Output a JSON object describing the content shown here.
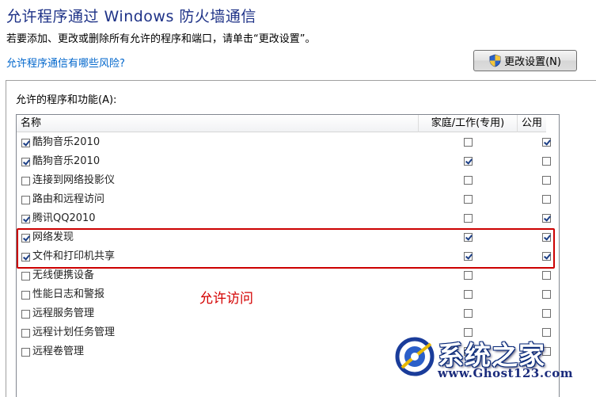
{
  "header": {
    "title": "允许程序通过 Windows 防火墙通信",
    "subtitle": "若要添加、更改或删除所有允许的程序和端口，请单击“更改设置”。",
    "risk_link": "允许程序通信有哪些风险?",
    "change_button": "更改设置(N)"
  },
  "panel": {
    "label": "允许的程序和功能(A):",
    "columns": {
      "name": "名称",
      "home_work": "家庭/工作(专用)",
      "public": "公用"
    },
    "rows": [
      {
        "name": "酷狗音乐2010",
        "enabled": true,
        "home": false,
        "public": true
      },
      {
        "name": "酷狗音乐2010",
        "enabled": true,
        "home": true,
        "public": false
      },
      {
        "name": "连接到网络投影仪",
        "enabled": false,
        "home": false,
        "public": false
      },
      {
        "name": "路由和远程访问",
        "enabled": false,
        "home": false,
        "public": false
      },
      {
        "name": "腾讯QQ2010",
        "enabled": true,
        "home": false,
        "public": true
      },
      {
        "name": "网络发现",
        "enabled": true,
        "home": true,
        "public": true
      },
      {
        "name": "文件和打印机共享",
        "enabled": true,
        "home": true,
        "public": true
      },
      {
        "name": "无线便携设备",
        "enabled": false,
        "home": false,
        "public": false
      },
      {
        "name": "性能日志和警报",
        "enabled": false,
        "home": false,
        "public": false
      },
      {
        "name": "远程服务管理",
        "enabled": false,
        "home": false,
        "public": false
      },
      {
        "name": "远程计划任务管理",
        "enabled": false,
        "home": false,
        "public": false
      },
      {
        "name": "远程卷管理",
        "enabled": false,
        "home": false,
        "public": false
      }
    ]
  },
  "annotation": "允许访问",
  "watermark": {
    "name": "系统之家",
    "url": "www.Ghost123.com"
  },
  "colors": {
    "title": "#1e3287",
    "link": "#0066cc",
    "highlight": "#cc0000",
    "check": "#1c3f86"
  }
}
